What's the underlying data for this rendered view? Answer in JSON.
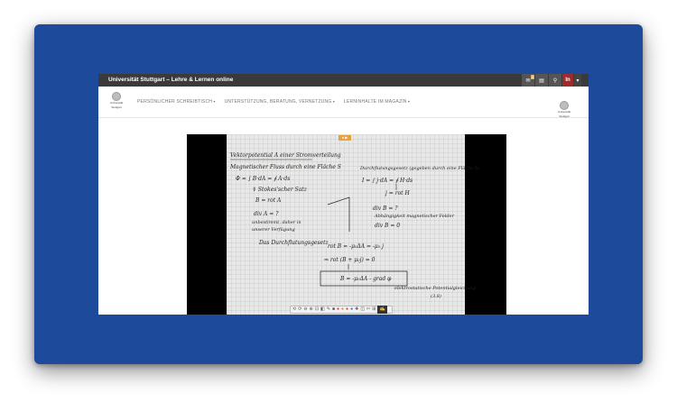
{
  "site": {
    "title": "Universität Stuttgart – Lehre & Lernen online",
    "badge_count": "2",
    "user_initials": "In"
  },
  "logo": {
    "text_line1": "Universität",
    "text_line2": "Stuttgart"
  },
  "nav": {
    "items": [
      {
        "label": "PERSÖNLICHER SCHREIBTISCH"
      },
      {
        "label": "UNTERSTÜTZUNG, BERATUNG, VERNETZUNG"
      },
      {
        "label": "LERNINHALTE IM MAGAZIN"
      }
    ]
  },
  "icons": {
    "mail": "mail-icon",
    "chat": "chat-icon",
    "search": "search-icon",
    "user": "user-icon",
    "caret": "chevron-down-icon"
  },
  "colors": {
    "frame": "#1d4a9a",
    "topbar": "#3a3a3a",
    "user_accent": "#9b2c2c",
    "badge": "#e6b85c"
  },
  "whiteboard": {
    "lines": [
      "Vektorpotential A einer Stromverteilung",
      "Magnetischer Fluss durch eine Fläche S",
      "Φ = ∫ B·dA = ∮ A·ds",
      "⇓ Stokes'scher Satz",
      "B = rot A",
      "div A = ?",
      "unbestimmt, daher in",
      "unserer Verfügung",
      "Durchflutungsgesetz (gegeben durch eine Fläche S)",
      "I = ∫ j·dA = ∮ H·ds",
      "j = rot H",
      "div B = ?",
      "Abhängigkeit magnetischer Felder",
      "div B = 0",
      "Das Durchflutungsgesetz",
      "rot B = -μ₀ΔA = -μ₀ j",
      "⇒ rot (B + μ₀j) = 0",
      "B = -μ₀ΔA - grad φ",
      "elektrostatische Potentialgleichung",
      "(3.8)"
    ]
  },
  "player": {
    "indicator": "● ▶",
    "toolbar": [
      "⟲",
      "⟳",
      "⊖",
      "⊕",
      "⊡",
      "◧",
      "✎",
      "■",
      "●",
      "●",
      "●",
      "●",
      "✚",
      "◫",
      "✄",
      "⊞",
      "✍"
    ]
  }
}
